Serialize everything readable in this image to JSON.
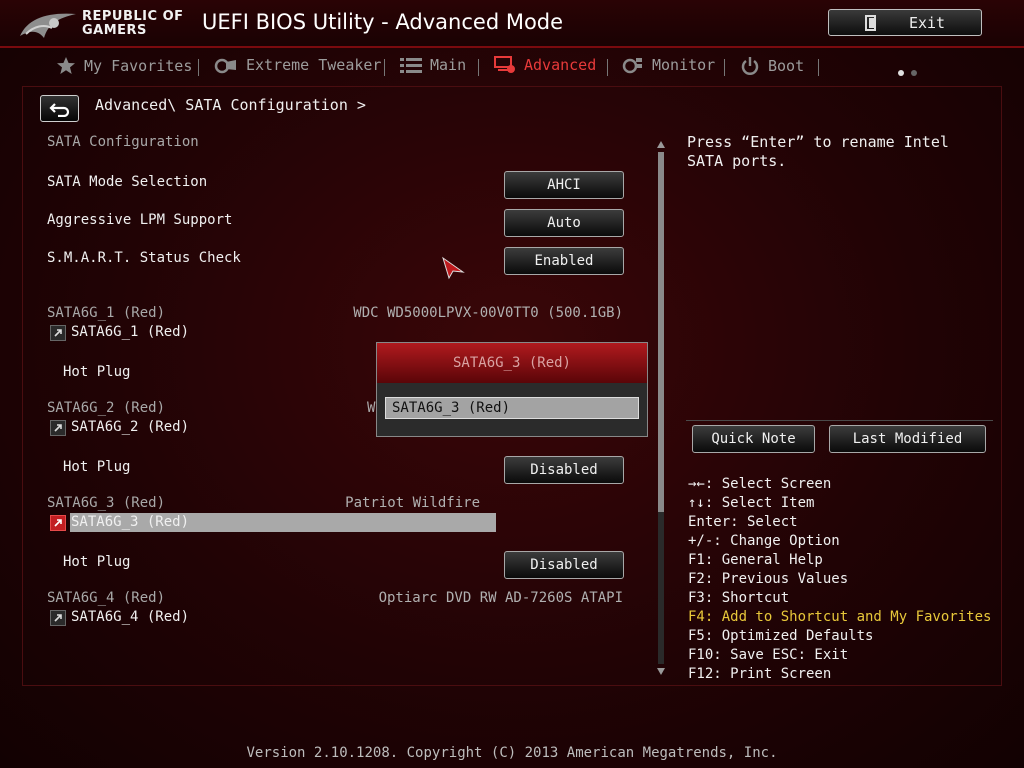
{
  "header": {
    "brand_line1": "REPUBLIC OF",
    "brand_line2": "GAMERS",
    "title": "UEFI BIOS Utility - Advanced Mode",
    "exit_label": "Exit"
  },
  "tabs": [
    {
      "label": "My Favorites",
      "icon": "star-icon",
      "active": false
    },
    {
      "label": "Extreme Tweaker",
      "icon": "tweaker-icon",
      "active": false
    },
    {
      "label": "Main",
      "icon": "list-icon",
      "active": false
    },
    {
      "label": "Advanced",
      "icon": "advanced-icon",
      "active": true
    },
    {
      "label": "Monitor",
      "icon": "monitor-icon",
      "active": false
    },
    {
      "label": "Boot",
      "icon": "power-icon",
      "active": false
    }
  ],
  "breadcrumb": "Advanced\\ SATA Configuration >",
  "settings": {
    "section_title": "SATA Configuration",
    "sata_mode": {
      "label": "SATA Mode Selection",
      "value": "AHCI"
    },
    "lpm": {
      "label": "Aggressive LPM Support",
      "value": "Auto"
    },
    "smart": {
      "label": "S.M.A.R.T. Status Check",
      "value": "Enabled"
    }
  },
  "ports": [
    {
      "header": "SATA6G_1 (Red)",
      "device": "WDC WD5000LPVX-00V0TT0 (500.1GB)",
      "link": "SATA6G_1 (Red)",
      "hot_plug_label": "Hot Plug",
      "hot_plug_value": ""
    },
    {
      "header": "SATA6G_2 (Red)",
      "device": "W",
      "link": "SATA6G_2 (Red)",
      "hot_plug_label": "Hot Plug",
      "hot_plug_value": "Disabled"
    },
    {
      "header": "SATA6G_3 (Red)",
      "device": "Patriot Wildfire",
      "link": "SATA6G_3 (Red)",
      "hot_plug_label": "Hot Plug",
      "hot_plug_value": "Disabled"
    },
    {
      "header": "SATA6G_4 (Red)",
      "device": "Optiarc DVD RW AD-7260S ATAPI",
      "link": "SATA6G_4 (Red)"
    }
  ],
  "popup": {
    "title": "SATA6G_3 (Red)",
    "input_value": "SATA6G_3 (Red)"
  },
  "help": {
    "text": "Press “Enter” to rename Intel SATA ports.",
    "quick_note": "Quick Note",
    "last_modified": "Last Modified"
  },
  "keys": [
    {
      "text": "→←: Select Screen",
      "hl": false
    },
    {
      "text": "↑↓: Select Item",
      "hl": false
    },
    {
      "text": "Enter: Select",
      "hl": false
    },
    {
      "text": "+/-: Change Option",
      "hl": false
    },
    {
      "text": "F1: General Help",
      "hl": false
    },
    {
      "text": "F2: Previous Values",
      "hl": false
    },
    {
      "text": "F3: Shortcut",
      "hl": false
    },
    {
      "text": "F4: Add to Shortcut and My Favorites",
      "hl": true
    },
    {
      "text": "F5: Optimized Defaults",
      "hl": false
    },
    {
      "text": "F10: Save  ESC: Exit",
      "hl": false
    },
    {
      "text": "F12: Print Screen",
      "hl": false
    }
  ],
  "footer": "Version 2.10.1208. Copyright (C) 2013 American Megatrends, Inc.",
  "colors": {
    "accent": "#e83a3a",
    "highlight": "#e8c83a",
    "selection": "#a9a9a9"
  }
}
